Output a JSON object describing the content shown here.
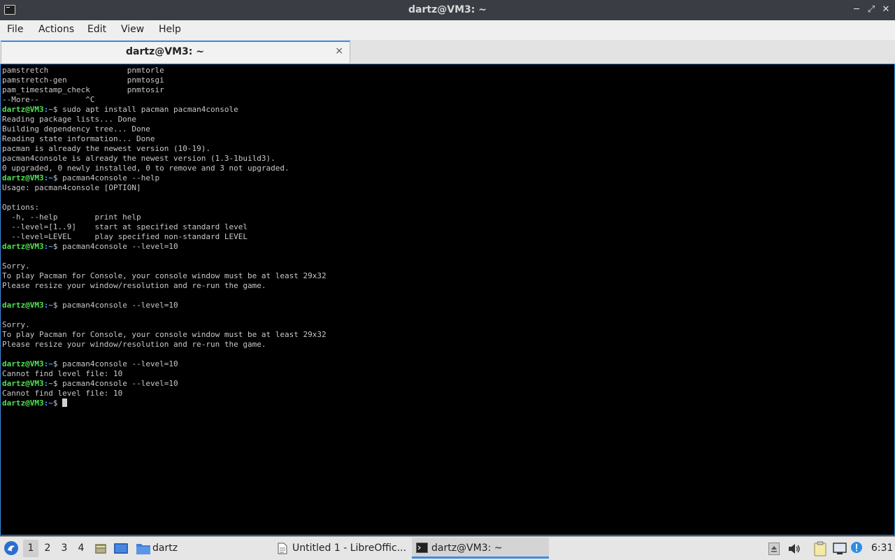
{
  "window": {
    "title": "dartz@VM3: ~",
    "minimize_icon": "minimize-icon",
    "maximize_icon": "restore-icon",
    "close_icon": "close-icon"
  },
  "menu": [
    "File",
    "Actions",
    "Edit",
    "View",
    "Help"
  ],
  "tab": {
    "label": "dartz@VM3: ~",
    "close_glyph": "×"
  },
  "prompt": {
    "user": "dartz@VM3",
    "path": ":~",
    "symbol": "$ "
  },
  "terminal_lines": [
    {
      "text": "pamstretch                 pnmtorle"
    },
    {
      "text": "pamstretch-gen             pnmtosgi"
    },
    {
      "text": "pam_timestamp_check        pnmtosir"
    },
    {
      "text": "--More--          ^C"
    },
    {
      "prompt": true,
      "text": "sudo apt install pacman pacman4console"
    },
    {
      "text": "Reading package lists... Done"
    },
    {
      "text": "Building dependency tree... Done"
    },
    {
      "text": "Reading state information... Done"
    },
    {
      "text": "pacman is already the newest version (10-19)."
    },
    {
      "text": "pacman4console is already the newest version (1.3-1build3)."
    },
    {
      "text": "0 upgraded, 0 newly installed, 0 to remove and 3 not upgraded."
    },
    {
      "prompt": true,
      "text": "pacman4console --help"
    },
    {
      "text": "Usage: pacman4console [OPTION]"
    },
    {
      "text": ""
    },
    {
      "text": "Options:"
    },
    {
      "text": "  -h, --help        print help"
    },
    {
      "text": "  --level=[1..9]    start at specified standard level"
    },
    {
      "text": "  --level=LEVEL     play specified non-standard LEVEL"
    },
    {
      "prompt": true,
      "text": "pacman4console --level=10"
    },
    {
      "text": ""
    },
    {
      "text": "Sorry."
    },
    {
      "text": "To play Pacman for Console, your console window must be at least 29x32"
    },
    {
      "text": "Please resize your window/resolution and re-run the game."
    },
    {
      "text": ""
    },
    {
      "prompt": true,
      "text": "pacman4console --level=10"
    },
    {
      "text": ""
    },
    {
      "text": "Sorry."
    },
    {
      "text": "To play Pacman for Console, your console window must be at least 29x32"
    },
    {
      "text": "Please resize your window/resolution and re-run the game."
    },
    {
      "text": ""
    },
    {
      "prompt": true,
      "text": "pacman4console --level=10"
    },
    {
      "text": "Cannot find level file: 10"
    },
    {
      "prompt": true,
      "text": "pacman4console --level=10"
    },
    {
      "text": "Cannot find level file: 10"
    },
    {
      "prompt": true,
      "text": "",
      "cursor": true
    }
  ],
  "taskbar": {
    "workspaces": [
      "1",
      "2",
      "3",
      "4"
    ],
    "active_workspace": "1",
    "folder_label": "dartz",
    "tasks": [
      {
        "label": "Untitled 1 - LibreOffic...",
        "icon": "document-icon"
      },
      {
        "label": "dartz@VM3: ~",
        "icon": "terminal-icon",
        "active": true
      }
    ],
    "clock": "6:31"
  },
  "colors": {
    "accent": "#3d8ee0",
    "prompt_user": "#4fe34f",
    "prompt_path": "#5aa0ff"
  }
}
